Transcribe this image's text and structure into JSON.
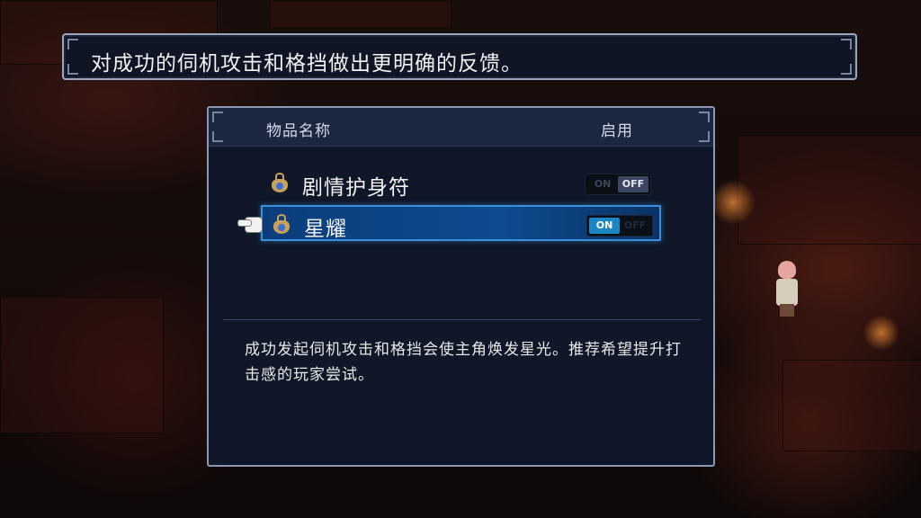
{
  "tooltip": {
    "text": "对成功的伺机攻击和格挡做出更明确的反馈。"
  },
  "panel": {
    "header": {
      "name_label": "物品名称",
      "enabled_label": "启用"
    },
    "items": [
      {
        "label": "剧情护身符",
        "icon": "amulet-icon",
        "toggle": {
          "on_label": "ON",
          "off_label": "OFF",
          "state": "off"
        }
      },
      {
        "label": "星耀",
        "icon": "amulet-icon",
        "toggle": {
          "on_label": "ON",
          "off_label": "OFF",
          "state": "on"
        },
        "selected": true
      }
    ],
    "description": "成功发起伺机攻击和格挡会使主角焕发星光。推荐希望提升打击感的玩家尝试。"
  },
  "colors": {
    "selection": "#0e4a8f",
    "toggle_on": "#1b86c4",
    "panel_bg": "#0f1728"
  }
}
